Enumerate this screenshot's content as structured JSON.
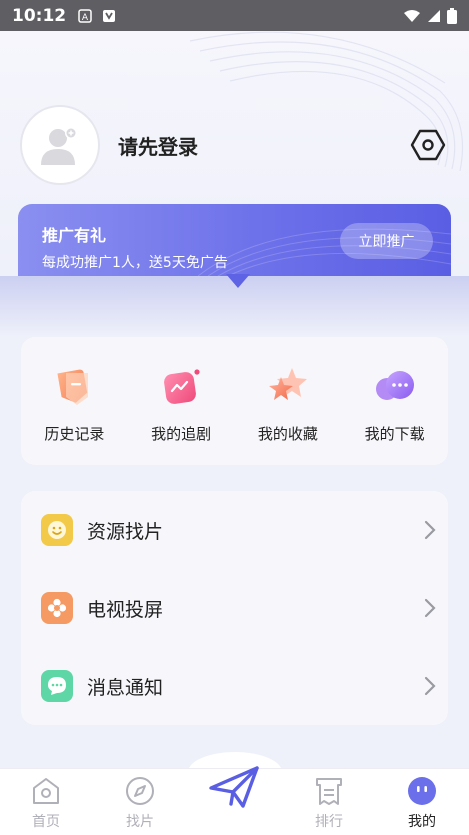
{
  "status_bar": {
    "time": "10:12"
  },
  "profile": {
    "login_text": "请先登录"
  },
  "promo": {
    "title": "推广有礼",
    "subtitle": "每成功推广1人，送5天免广告",
    "button_label": "立即推广"
  },
  "quick_actions": [
    {
      "label": "历史记录",
      "icon": "history-icon"
    },
    {
      "label": "我的追剧",
      "icon": "drama-icon"
    },
    {
      "label": "我的收藏",
      "icon": "star-icon"
    },
    {
      "label": "我的下载",
      "icon": "download-icon"
    }
  ],
  "menu": [
    {
      "label": "资源找片",
      "icon": "smiley-icon",
      "color": "#f3c94a"
    },
    {
      "label": "电视投屏",
      "icon": "flower-icon",
      "color": "#f59a62"
    },
    {
      "label": "消息通知",
      "icon": "message-icon",
      "color": "#5fd6a6"
    }
  ],
  "tabbar": {
    "items": [
      {
        "label": "首页",
        "icon": "home-icon"
      },
      {
        "label": "找片",
        "icon": "compass-icon"
      },
      {
        "label": "排行",
        "icon": "ranking-icon"
      },
      {
        "label": "我的",
        "icon": "profile-face-icon"
      }
    ],
    "active_index": 3,
    "accent": "#6b6fe9"
  }
}
